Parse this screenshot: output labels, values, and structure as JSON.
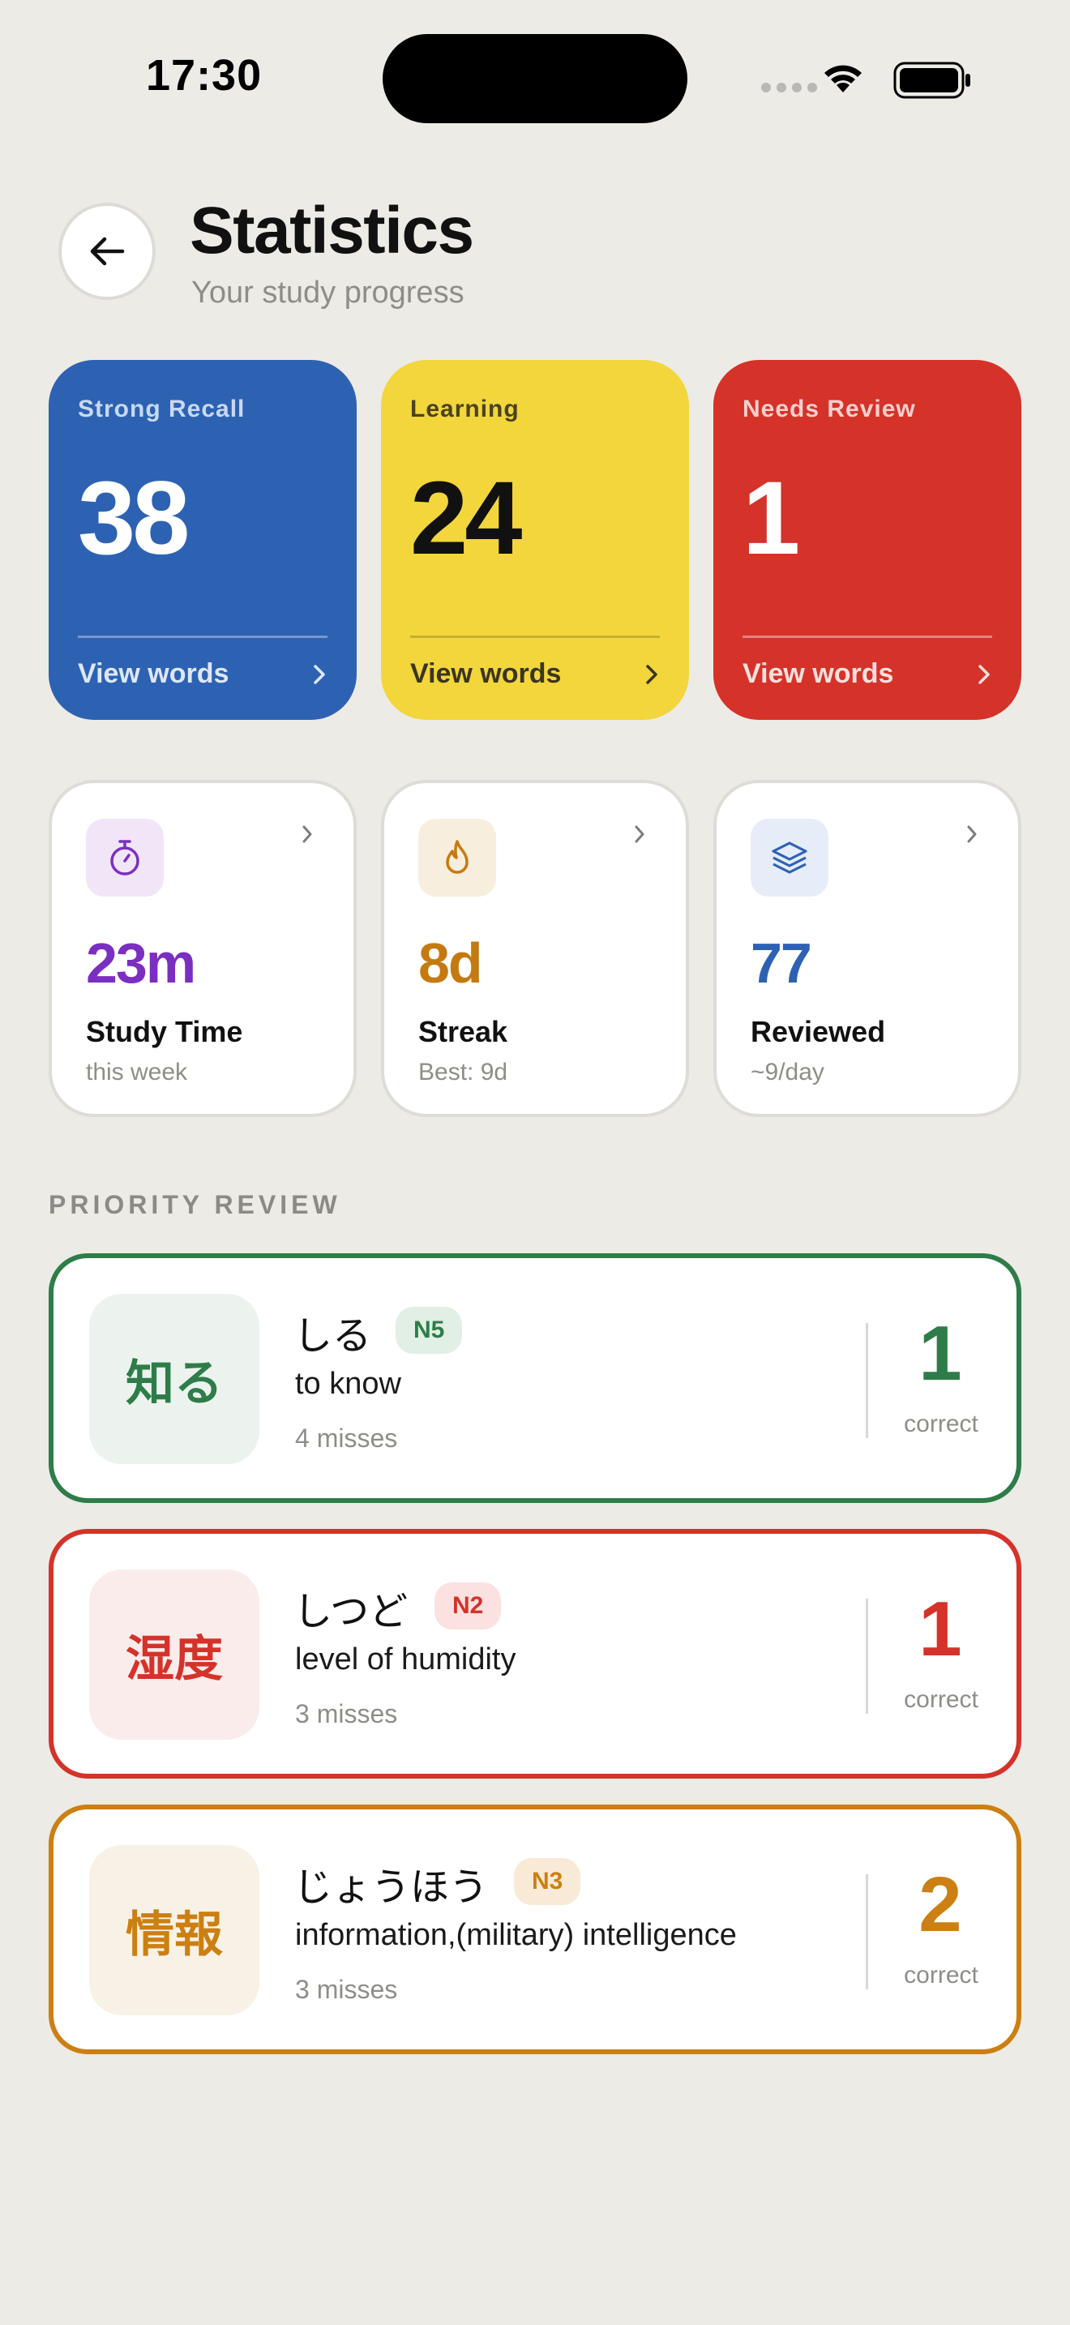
{
  "status_bar": {
    "time": "17:30"
  },
  "header": {
    "title": "Statistics",
    "subtitle": "Your study progress"
  },
  "summary_cards": [
    {
      "label": "Strong Recall",
      "value": "38",
      "link": "View words",
      "color": "#2d62b3"
    },
    {
      "label": "Learning",
      "value": "24",
      "link": "View words",
      "color": "#f2d63c"
    },
    {
      "label": "Needs Review",
      "value": "1",
      "link": "View words",
      "color": "#d5322a"
    }
  ],
  "metric_cards": [
    {
      "value": "23m",
      "label": "Study Time",
      "sub": "this week",
      "icon": "stopwatch-icon",
      "color": "#7b2fc0"
    },
    {
      "value": "8d",
      "label": "Streak",
      "sub": "Best: 9d",
      "icon": "flame-icon",
      "color": "#c57a10"
    },
    {
      "value": "77",
      "label": "Reviewed",
      "sub": "~9/day",
      "icon": "layers-icon",
      "color": "#2d62b3"
    }
  ],
  "priority_review": {
    "section_label": "PRIORITY REVIEW",
    "items": [
      {
        "kanji": "知る",
        "reading": "しる",
        "level": "N5",
        "meaning": "to know",
        "misses": "4 misses",
        "count": "1",
        "count_label": "correct",
        "color": "#2e7d48"
      },
      {
        "kanji": "湿度",
        "reading": "しつど",
        "level": "N2",
        "meaning": "level of humidity",
        "misses": "3 misses",
        "count": "1",
        "count_label": "correct",
        "color": "#d5322a"
      },
      {
        "kanji": "情報",
        "reading": "じょうほう",
        "level": "N3",
        "meaning": "information,(military) intelligence",
        "misses": "3 misses",
        "count": "2",
        "count_label": "correct",
        "color": "#cc7f12"
      }
    ]
  }
}
